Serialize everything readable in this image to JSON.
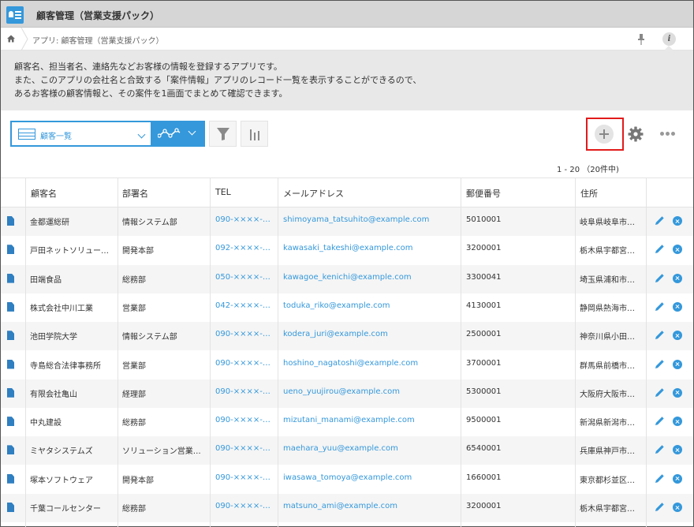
{
  "colors": {
    "accent": "#3498db",
    "highlight": "#e21b1b",
    "header_bg": "#d6d6d6",
    "desc_bg": "#e8e8e8"
  },
  "app": {
    "title": "顧客管理（営業支援パック）",
    "icon": "customer-card-icon"
  },
  "breadcrumb": {
    "text": "アプリ: 顧客管理（営業支援パック）"
  },
  "description": {
    "lines": [
      "顧客名、担当者名、連絡先などお客様の情報を登録するアプリです。",
      "また、このアプリの会社名と合致する「案件情報」アプリのレコード一覧を表示することができるので、",
      "あるお客様の顧客情報と、その案件を1画面でまとめて確認できます。"
    ]
  },
  "toolbar": {
    "view_label": "顧客一覧",
    "count_label": "1 - 20 （20件中)"
  },
  "table": {
    "headers": [
      "顧客名",
      "部署名",
      "TEL",
      "メールアドレス",
      "郵便番号",
      "住所"
    ],
    "rows": [
      [
        "金都運総研",
        "情報システム部",
        "090-××××-…",
        "shimoyama_tatsuhito@example.com",
        "5010001",
        "岐阜県岐阜市…"
      ],
      [
        "戸田ネットソリュー…",
        "開発本部",
        "092-××××-…",
        "kawasaki_takeshi@example.com",
        "3200001",
        "栃木県宇都宮…"
      ],
      [
        "田端食品",
        "総務部",
        "050-××××-…",
        "kawagoe_kenichi@example.com",
        "3300041",
        "埼玉県浦和市…"
      ],
      [
        "株式会社中川工業",
        "営業部",
        "042-××××-…",
        "toduka_riko@example.com",
        "4130001",
        "静岡県熱海市…"
      ],
      [
        "池田学院大学",
        "情報システム部",
        "090-××××-…",
        "kodera_juri@example.com",
        "2500001",
        "神奈川県小田…"
      ],
      [
        "寺島総合法律事務所",
        "営業部",
        "090-××××-…",
        "hoshino_nagatoshi@example.com",
        "3700001",
        "群馬県前橋市…"
      ],
      [
        "有限会社亀山",
        "経理部",
        "090-××××-…",
        "ueno_yuujirou@example.com",
        "5300001",
        "大阪府大阪市…"
      ],
      [
        "中丸建設",
        "総務部",
        "090-××××-…",
        "mizutani_manami@example.com",
        "9500001",
        "新潟県新潟市…"
      ],
      [
        "ミヤタシステムズ",
        "ソリューション営業…",
        "090-××××-…",
        "maehara_yuu@example.com",
        "6540001",
        "兵庫県神戸市…"
      ],
      [
        "塚本ソフトウェア",
        "開発本部",
        "090-××××-…",
        "iwasawa_tomoya@example.com",
        "1660001",
        "東京都杉並区…"
      ],
      [
        "千葉コールセンター",
        "総務部",
        "090-××××-…",
        "matsuno_ami@example.com",
        "3200001",
        "栃木県宇都宮…"
      ]
    ]
  }
}
